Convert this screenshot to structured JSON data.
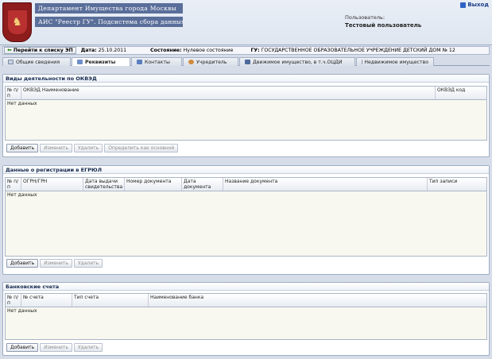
{
  "header": {
    "department": "Департамент Имущества города Москвы",
    "system": "АИС \"Реестр ГУ\". Подсистема сбора данных",
    "logout": "Выход",
    "user_label": "Пользователь:",
    "user_name": "Тестовый пользователь"
  },
  "infobar": {
    "back_button": "Перейти к списку ЭП",
    "date_label": "Дата:",
    "date_value": "25.10.2011",
    "state_label": "Состояние:",
    "state_value": "Нулевое состояние",
    "gu_label": "ГУ:",
    "gu_value": "ГОСУДАРСТВЕННОЕ ОБРАЗОВАТЕЛЬНОЕ УЧРЕЖДЕНИЕ ДЕТСКИЙ ДОМ № 12"
  },
  "tabs": [
    {
      "label": "Общие сведения",
      "icon": "page-icon",
      "active": false
    },
    {
      "label": "Реквизиты",
      "icon": "card-icon",
      "active": true
    },
    {
      "label": "Контакты",
      "icon": "phone-icon",
      "active": false
    },
    {
      "label": "Учредитель",
      "icon": "person-icon",
      "active": false
    },
    {
      "label": "Движимое имущество, в т.ч.ОЦДИ",
      "icon": "car-icon",
      "active": false
    },
    {
      "label": "Недвижимое имущество",
      "icon": "building-icon",
      "active": false
    }
  ],
  "okved": {
    "title": "Виды деятельности по ОКВЭД",
    "columns": [
      "№ п/п",
      "ОКВЭД Наименование",
      "ОКВЭД код"
    ],
    "empty": "Нет данных",
    "buttons": [
      "Добавить",
      "Изменить",
      "Удалить",
      "Определить как основной"
    ]
  },
  "egrul": {
    "title": "Данные о регистрации в ЕГРЮЛ",
    "columns": [
      "№ п/п",
      "ОГРН/ГРН",
      "Дата выдачи свидетельства",
      "Номер документа",
      "Дата документа",
      "Название документа",
      "Тип записи"
    ],
    "empty": "Нет данных",
    "buttons": [
      "Добавить",
      "Изменить",
      "Удалить"
    ]
  },
  "bank": {
    "title": "Банковские счета",
    "columns": [
      "№ п/п",
      "№ счета",
      "Тип счета",
      "Наименование банка"
    ],
    "empty": "Нет данных",
    "buttons": [
      "Добавить",
      "Изменить",
      "Удалить"
    ]
  },
  "colors": {
    "brand_band": "#5a6e9a",
    "emblem": "#8d1c1c",
    "active_tab": "#ffffff",
    "grid_bg": "#f8f8f0"
  }
}
